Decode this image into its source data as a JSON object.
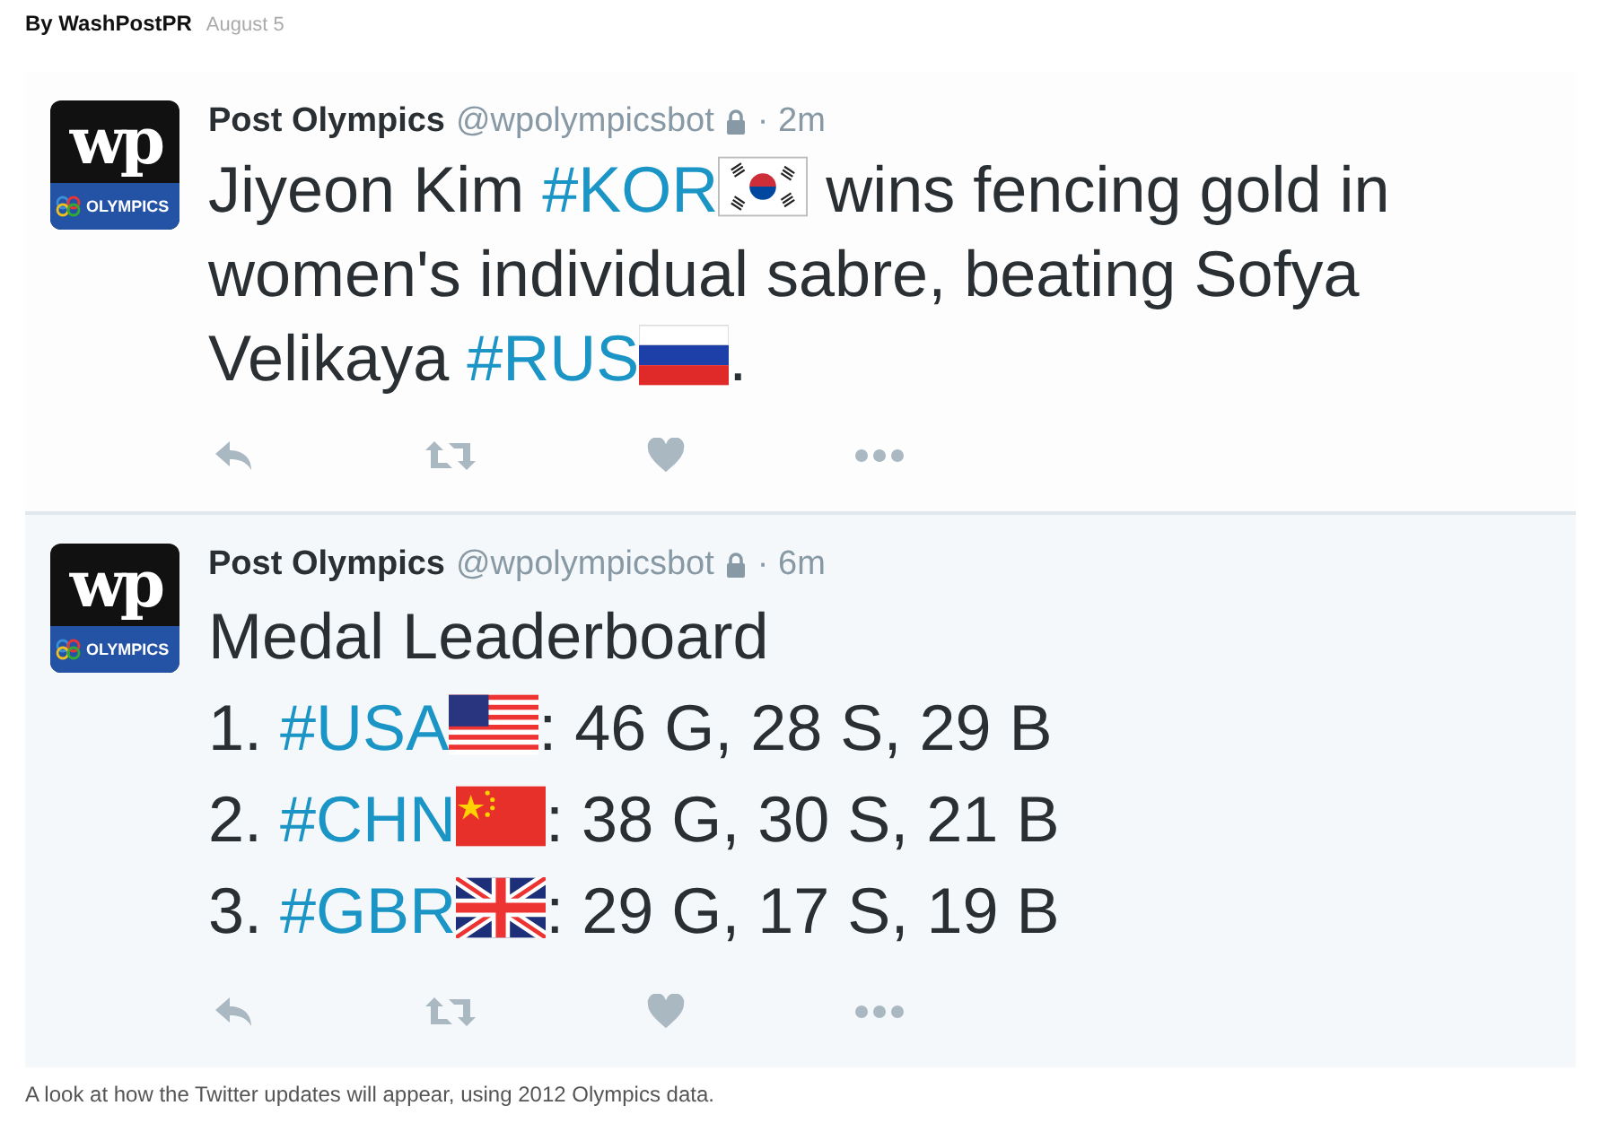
{
  "byline": {
    "author": "By WashPostPR",
    "date": "August 5"
  },
  "tweets": [
    {
      "avatar": {
        "mark": "wp",
        "label": "OLYMPICS"
      },
      "name": "Post Olympics",
      "handle": "@wpolympicsbot",
      "protected": true,
      "time": "· 2m",
      "lines": [
        [
          {
            "kind": "text",
            "text": "Jiyeon Kim "
          },
          {
            "kind": "tag",
            "text": "#KOR"
          },
          {
            "kind": "korea"
          },
          {
            "kind": "text",
            "text": " wins fencing gold in women's individual sabre, beating Sofya Velikaya "
          },
          {
            "kind": "tag",
            "text": "#RUS"
          },
          {
            "kind": "russia"
          },
          {
            "kind": "text",
            "text": "."
          }
        ]
      ]
    },
    {
      "avatar": {
        "mark": "wp",
        "label": "OLYMPICS"
      },
      "name": "Post Olympics",
      "handle": "@wpolympicsbot",
      "protected": true,
      "time": "· 6m",
      "lines": [
        [
          {
            "kind": "text",
            "text": "Medal Leaderboard"
          }
        ],
        [
          {
            "kind": "text",
            "text": "1. "
          },
          {
            "kind": "tag",
            "text": "#USA"
          },
          {
            "kind": "usa"
          },
          {
            "kind": "text",
            "text": ": 46 G, 28 S, 29 B"
          }
        ],
        [
          {
            "kind": "text",
            "text": "2. "
          },
          {
            "kind": "tag",
            "text": "#CHN"
          },
          {
            "kind": "china"
          },
          {
            "kind": "text",
            "text": ": 38 G, 30 S, 21 B"
          }
        ],
        [
          {
            "kind": "text",
            "text": "3. "
          },
          {
            "kind": "tag",
            "text": "#GBR"
          },
          {
            "kind": "britain"
          },
          {
            "kind": "text",
            "text": ": 29 G, 17 S, 19 B"
          }
        ]
      ]
    }
  ],
  "caption": "A look at how the Twitter updates will appear, using 2012 Olympics data."
}
